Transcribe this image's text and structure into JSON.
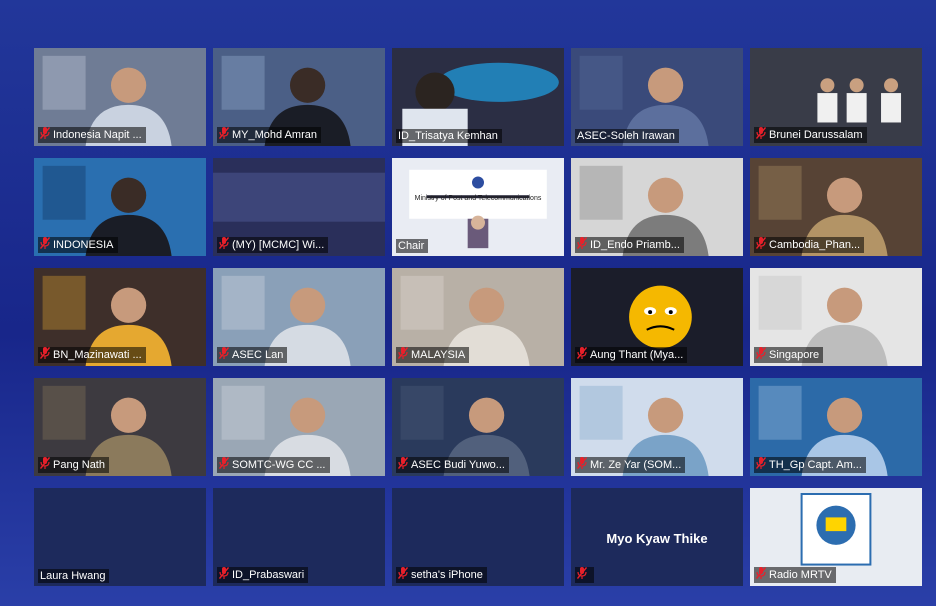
{
  "meeting": {
    "colors": {
      "active_border": "#a6e02a",
      "muted_mic": "#e8202a",
      "tile_empty": "#1d2a5c"
    },
    "participants": [
      {
        "name": "Indonesia Napit ...",
        "muted": true
      },
      {
        "name": "MY_Mohd Amran",
        "muted": true
      },
      {
        "name": "ID_Trisatya Kemhan",
        "muted": false
      },
      {
        "name": "ASEC-Soleh Irawan",
        "muted": false,
        "active_speaker": true
      },
      {
        "name": "Brunei Darussalam",
        "muted": true
      },
      {
        "name": "INDONESIA",
        "muted": true
      },
      {
        "name": "(MY) [MCMC] Wi...",
        "muted": true
      },
      {
        "name": "Chair",
        "muted": false,
        "slide_text": [
          "Ministry of Post and Telecommunications"
        ]
      },
      {
        "name": "ID_Endo Priamb...",
        "muted": true
      },
      {
        "name": "Cambodia_Phan...",
        "muted": true
      },
      {
        "name": "BN_Mazinawati ...",
        "muted": true
      },
      {
        "name": "ASEC Lan",
        "muted": true
      },
      {
        "name": "MALAYSIA",
        "muted": true
      },
      {
        "name": "Aung Thant (Mya...",
        "muted": true
      },
      {
        "name": "Singapore",
        "muted": true
      },
      {
        "name": "Pang Nath",
        "muted": true
      },
      {
        "name": "SOMTC-WG CC ...",
        "muted": true
      },
      {
        "name": "ASEC Budi Yuwo...",
        "muted": true
      },
      {
        "name": "Mr. Ze Yar (SOM...",
        "muted": true
      },
      {
        "name": "TH_Gp Capt. Am...",
        "muted": true
      },
      {
        "name": "Laura Hwang",
        "muted": false,
        "video_off": true
      },
      {
        "name": "ID_Prabaswari",
        "muted": true,
        "video_off": true
      },
      {
        "name": "setha's iPhone",
        "muted": true,
        "video_off": true
      },
      {
        "name": "",
        "display_name": "Myo Kyaw Thike",
        "muted": true,
        "video_off": true
      },
      {
        "name": "Radio MRTV",
        "muted": true,
        "logo": "radio-mrtv-logo"
      }
    ]
  }
}
